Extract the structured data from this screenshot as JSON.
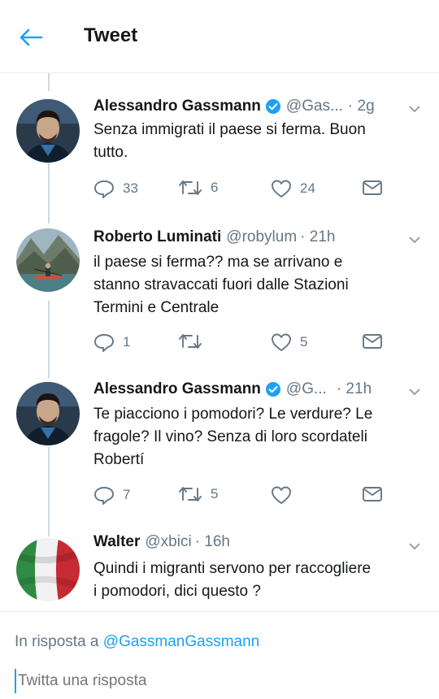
{
  "header": {
    "title": "Tweet",
    "accent_color": "#1da1f2"
  },
  "tweets": [
    {
      "name": "Alessandro Gassmann",
      "verified": true,
      "handle": "@Gas...",
      "time": "· 2g",
      "text_lines": [
        "Senza immigrati il paese si ferma. Buon",
        "tutto."
      ],
      "reply_count": "33",
      "retweet_count": "6",
      "like_count": "24",
      "avatar_icon": "man-portrait-avatar"
    },
    {
      "name": "Roberto Luminati",
      "verified": false,
      "handle": "@robylum",
      "time": "· 21h",
      "text_lines": [
        "il paese si ferma?? ma se arrivano e",
        "stanno stravaccati fuori dalle Stazioni",
        "Termini e Centrale"
      ],
      "reply_count": "1",
      "retweet_count": "",
      "like_count": "5",
      "avatar_icon": "landscape-kayak-avatar"
    },
    {
      "name": "Alessandro Gassmann",
      "verified": true,
      "handle": "@G...",
      "time": "· 21h",
      "text_lines": [
        "Te piacciono i pomodori? Le verdure? Le",
        "fragole? Il vino? Senza di loro scordateli",
        "Robertí"
      ],
      "reply_count": "7",
      "retweet_count": "5",
      "like_count": "",
      "avatar_icon": "man-portrait-avatar"
    },
    {
      "name": "Walter",
      "verified": false,
      "handle": "@xbici",
      "time": "· 16h",
      "text_lines": [
        "Quindi i migranti servono per raccogliere",
        "i pomodori, dici questo ?"
      ],
      "avatar_icon": "italian-flag-avatar"
    }
  ],
  "reply": {
    "context_prefix": "In risposta a",
    "context_mention": "@GassmanGassmann",
    "placeholder": "Twitta una risposta"
  }
}
